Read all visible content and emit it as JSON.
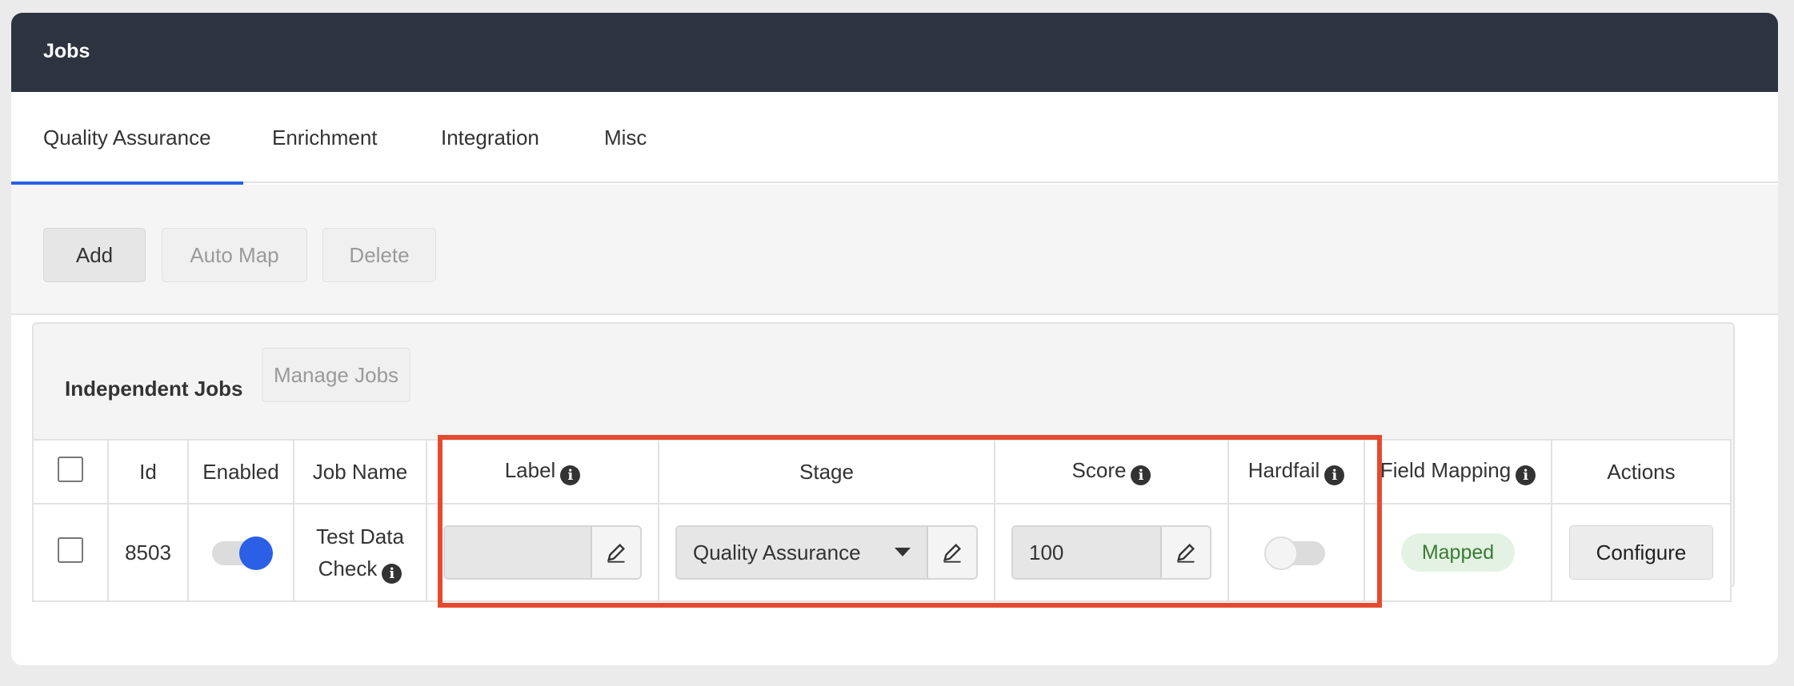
{
  "window": {
    "title": "Jobs"
  },
  "tabs": [
    {
      "label": "Quality Assurance",
      "active": true
    },
    {
      "label": "Enrichment",
      "active": false
    },
    {
      "label": "Integration",
      "active": false
    },
    {
      "label": "Misc",
      "active": false
    }
  ],
  "toolbar": {
    "add_label": "Add",
    "auto_map_label": "Auto Map",
    "delete_label": "Delete"
  },
  "panel": {
    "heading": "Independent Jobs",
    "manage_label": "Manage Jobs"
  },
  "table": {
    "headers": {
      "id": "Id",
      "enabled": "Enabled",
      "job_name": "Job Name",
      "label": "Label",
      "stage": "Stage",
      "score": "Score",
      "hardfail": "Hardfail",
      "field_mapping": "Field Mapping",
      "actions": "Actions"
    },
    "rows": [
      {
        "id": "8503",
        "enabled": true,
        "job_name_line1": "Test Data",
        "job_name_line2": "Check",
        "label_value": "",
        "stage_value": "Quality Assurance",
        "score_value": "100",
        "hardfail": false,
        "field_mapping": "Mapped",
        "action_label": "Configure"
      }
    ]
  },
  "colors": {
    "accent": "#2b5fe6",
    "header_bg": "#2d3440",
    "highlight": "#e64a2e",
    "badge_text": "#3a7a32"
  },
  "icons": {
    "info": "info-icon",
    "edit": "pencil-icon",
    "dropdown": "caret-down-icon"
  }
}
